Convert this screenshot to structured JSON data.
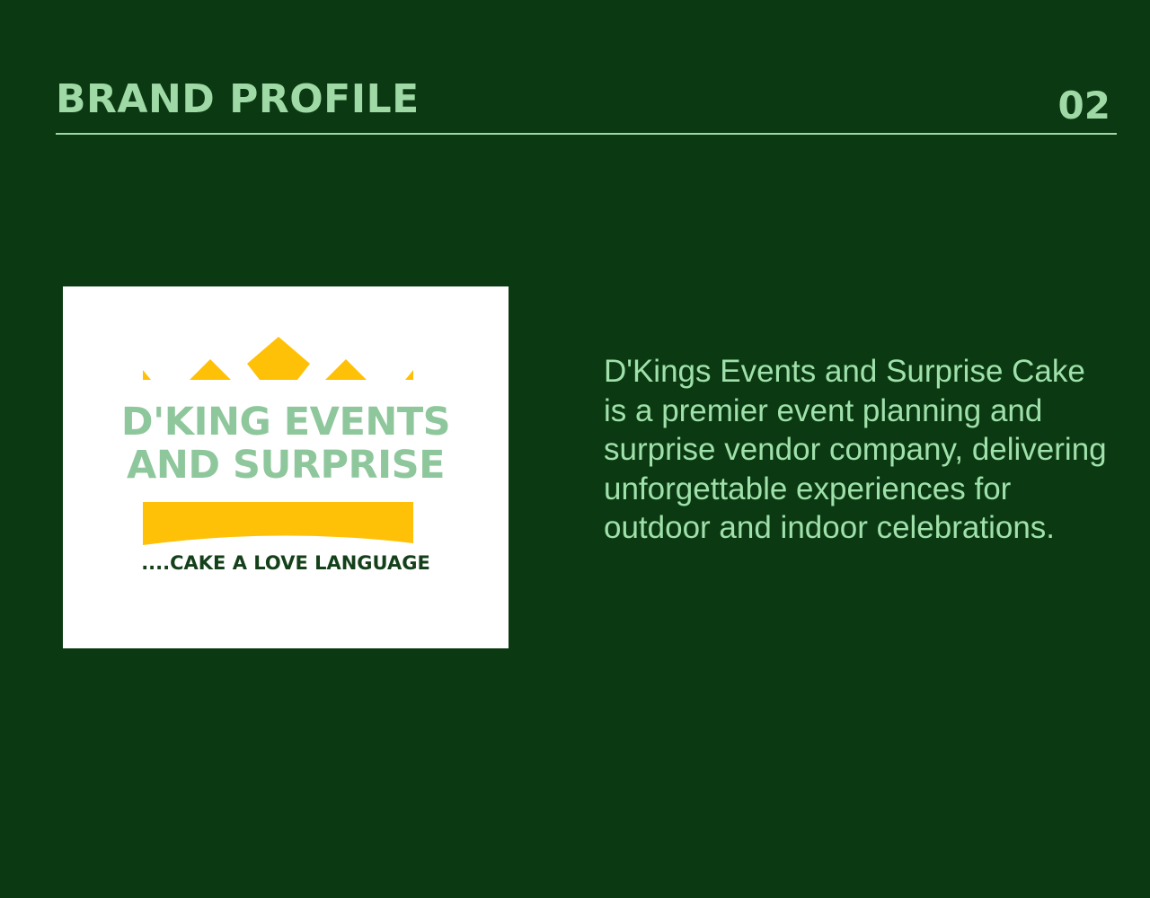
{
  "header": {
    "title": "BRAND PROFILE",
    "page_number": "02"
  },
  "logo": {
    "line1": "D'KING EVENTS",
    "line2": "AND SURPRISE",
    "tagline": "....CAKE A LOVE LANGUAGE",
    "crown_color": "#FFC107",
    "text_color": "#8FC79C",
    "tagline_color": "#14401A"
  },
  "description": {
    "text": "D'Kings Events and Surprise Cake is a premier event planning and surprise vendor company, delivering unforgettable experiences for outdoor and indoor celebrations."
  },
  "colors": {
    "background": "#0B3A12",
    "accent": "#9FD9A6"
  }
}
